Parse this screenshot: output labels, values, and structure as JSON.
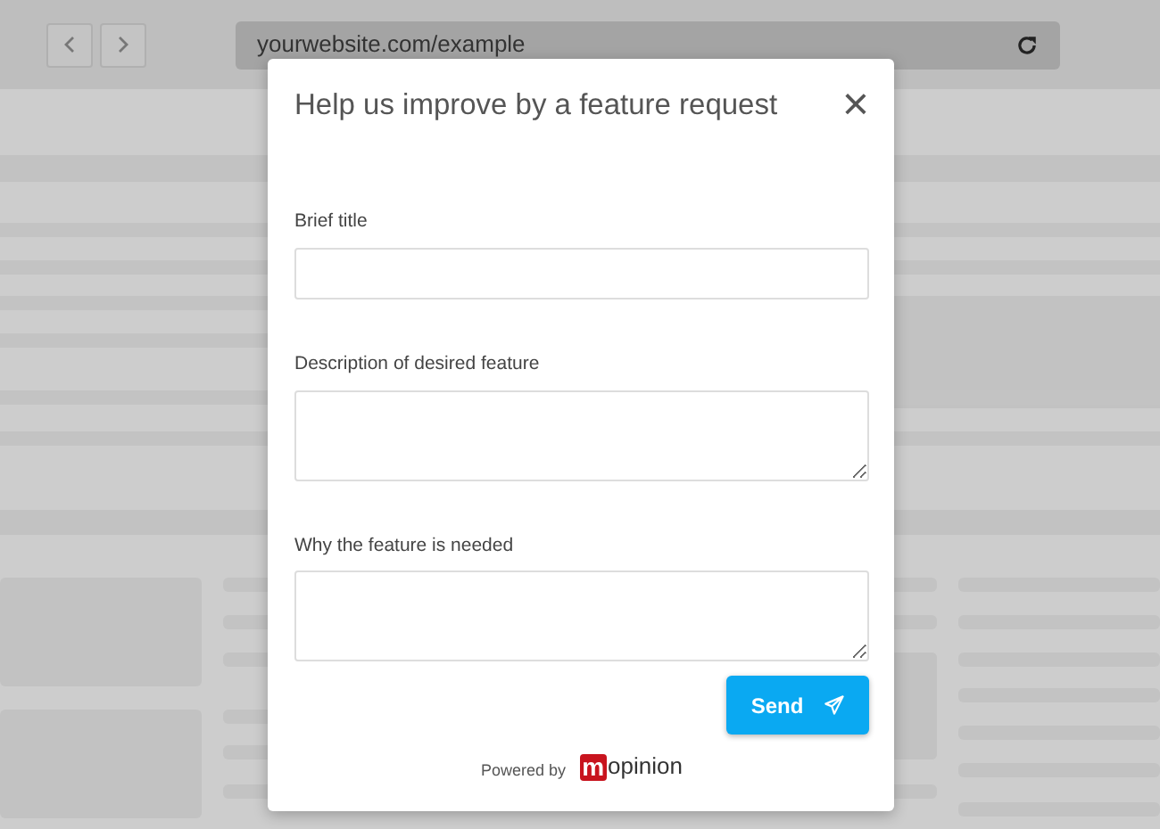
{
  "browser": {
    "url": "yourwebsite.com/example"
  },
  "dialog": {
    "title": "Help us improve by a feature request",
    "close": "×",
    "fields": [
      {
        "label": "Brief title",
        "kind": "input"
      },
      {
        "label": "Description of desired feature",
        "kind": "textarea"
      },
      {
        "label": "Why the feature is needed",
        "kind": "textarea"
      }
    ],
    "send_button": "Send",
    "footer": {
      "powered_by": "Powered by",
      "brand_mark": "m",
      "brand_name": "opinion"
    }
  }
}
